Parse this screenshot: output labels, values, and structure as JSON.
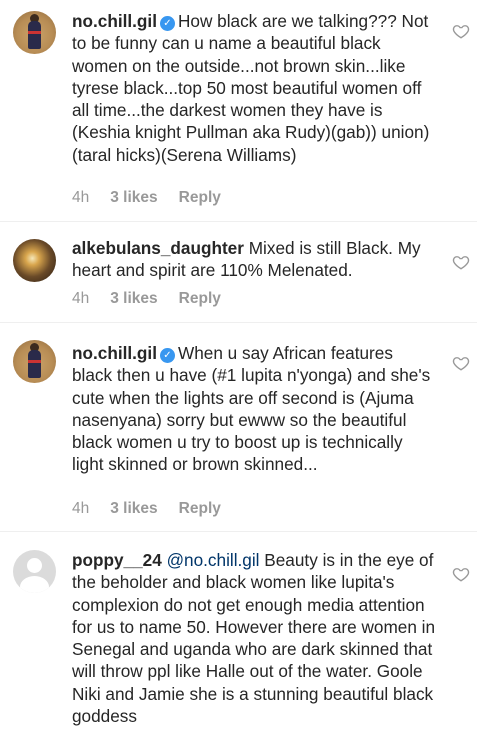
{
  "comments": [
    {
      "username": "no.chill.gil",
      "verified": true,
      "text": "How black are we talking??? Not to be funny can u name a beautiful black women on the outside...not brown skin...like tyrese black...top 50 most beautiful women off all time...the darkest women they have is (Keshia knight Pullman aka Rudy)(gab)) union)(taral hicks)(Serena Williams)",
      "time": "4h",
      "likes": "3 likes",
      "reply": "Reply"
    },
    {
      "username": "alkebulans_daughter",
      "verified": false,
      "text": "Mixed is still Black. My heart and spirit are 110% Melenated.",
      "time": "4h",
      "likes": "3 likes",
      "reply": "Reply"
    },
    {
      "username": "no.chill.gil",
      "verified": true,
      "text": "When u say African features black then u have (#1 lupita n'yonga) and she's cute when the lights are off second is (Ajuma nasenyana) sorry but ewww so the beautiful black women u try to boost up is technically light skinned or brown skinned...",
      "time": "4h",
      "likes": "3 likes",
      "reply": "Reply"
    },
    {
      "username": "poppy__24",
      "verified": false,
      "mention": "@no.chill.gil",
      "text": "Beauty is in the eye of the beholder and black women like lupita's complexion do not get enough media attention for us to name 50. However there are women in Senegal and uganda who are dark skinned that will throw ppl like Halle out of the water. Goole Niki and Jamie she is a stunning beautiful black goddess"
    }
  ]
}
